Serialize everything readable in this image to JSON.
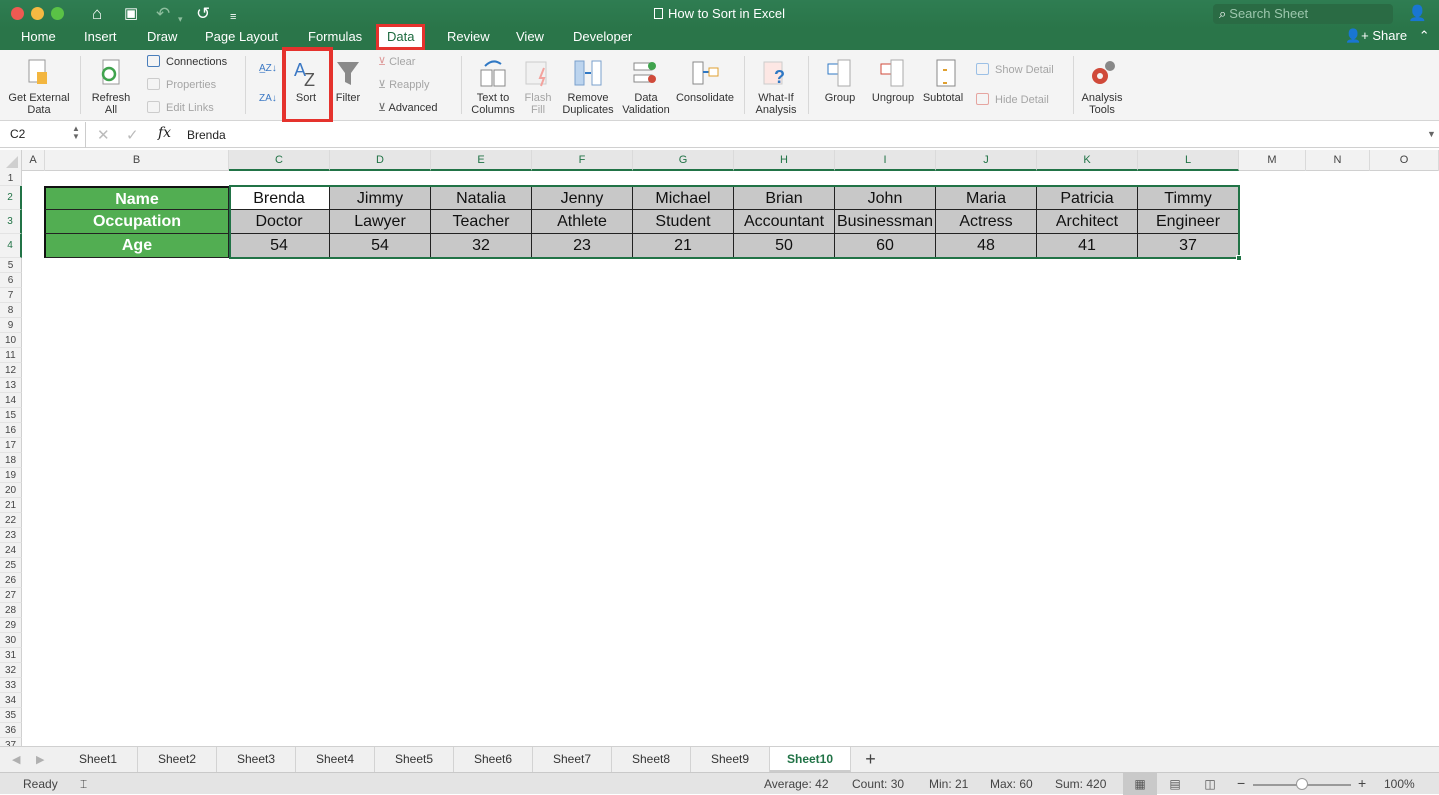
{
  "window": {
    "title": "How to Sort in Excel",
    "search_placeholder": "Search Sheet"
  },
  "ribbon_tabs": [
    {
      "label": "Home"
    },
    {
      "label": "Insert"
    },
    {
      "label": "Draw"
    },
    {
      "label": "Page Layout"
    },
    {
      "label": "Formulas"
    },
    {
      "label": "Data",
      "active": true
    },
    {
      "label": "Review"
    },
    {
      "label": "View"
    },
    {
      "label": "Developer"
    }
  ],
  "share_label": "Share",
  "ribbon": {
    "get_external_data": "Get External Data",
    "refresh_all": "Refresh All",
    "connections": "Connections",
    "properties": "Properties",
    "edit_links": "Edit Links",
    "sort_az": "A→Z",
    "sort_za": "Z→A",
    "sort": "Sort",
    "filter": "Filter",
    "clear": "Clear",
    "reapply": "Reapply",
    "advanced": "Advanced",
    "text_to_columns": "Text to Columns",
    "flash_fill": "Flash Fill",
    "remove_duplicates": "Remove Duplicates",
    "data_validation": "Data Validation",
    "consolidate": "Consolidate",
    "what_if": "What-If Analysis",
    "group": "Group",
    "ungroup": "Ungroup",
    "subtotal": "Subtotal",
    "show_detail": "Show Detail",
    "hide_detail": "Hide Detail",
    "analysis_tools": "Analysis Tools"
  },
  "formula_bar": {
    "name_box": "C2",
    "fx": "fx",
    "value": "Brenda"
  },
  "columns": [
    "A",
    "B",
    "C",
    "D",
    "E",
    "F",
    "G",
    "H",
    "I",
    "J",
    "K",
    "L",
    "M",
    "N",
    "O"
  ],
  "rows": [
    "1",
    "2",
    "3",
    "4",
    "5",
    "6",
    "7",
    "8",
    "9",
    "10",
    "11",
    "12",
    "13",
    "14",
    "15",
    "16",
    "17",
    "18",
    "19",
    "20",
    "21",
    "22",
    "23",
    "24",
    "25",
    "26",
    "27",
    "28",
    "29",
    "30",
    "31",
    "32",
    "33",
    "34",
    "35",
    "36",
    "37"
  ],
  "table": {
    "row_headers": [
      "Name",
      "Occupation",
      "Age"
    ],
    "records": [
      {
        "name": "Brenda",
        "occupation": "Doctor",
        "age": "54"
      },
      {
        "name": "Jimmy",
        "occupation": "Lawyer",
        "age": "54"
      },
      {
        "name": "Natalia",
        "occupation": "Teacher",
        "age": "32"
      },
      {
        "name": "Jenny",
        "occupation": "Athlete",
        "age": "23"
      },
      {
        "name": "Michael",
        "occupation": "Student",
        "age": "21"
      },
      {
        "name": "Brian",
        "occupation": "Accountant",
        "age": "50"
      },
      {
        "name": "John",
        "occupation": "Businessman",
        "age": "60"
      },
      {
        "name": "Maria",
        "occupation": "Actress",
        "age": "48"
      },
      {
        "name": "Patricia",
        "occupation": "Architect",
        "age": "41"
      },
      {
        "name": "Timmy",
        "occupation": "Engineer",
        "age": "37"
      }
    ],
    "header_color": "#52ae52",
    "data_color": "#c8c8c8"
  },
  "sheets": [
    "Sheet1",
    "Sheet2",
    "Sheet3",
    "Sheet4",
    "Sheet5",
    "Sheet6",
    "Sheet7",
    "Sheet8",
    "Sheet9",
    "Sheet10"
  ],
  "active_sheet": "Sheet10",
  "add_sheet": "+",
  "status": {
    "ready": "Ready",
    "average": "Average: 42",
    "count": "Count: 30",
    "min": "Min: 21",
    "max": "Max: 60",
    "sum": "Sum: 420",
    "zoom": "100%",
    "zoom_minus": "−",
    "zoom_plus": "+",
    "zoom_level_fraction": 0.5
  }
}
